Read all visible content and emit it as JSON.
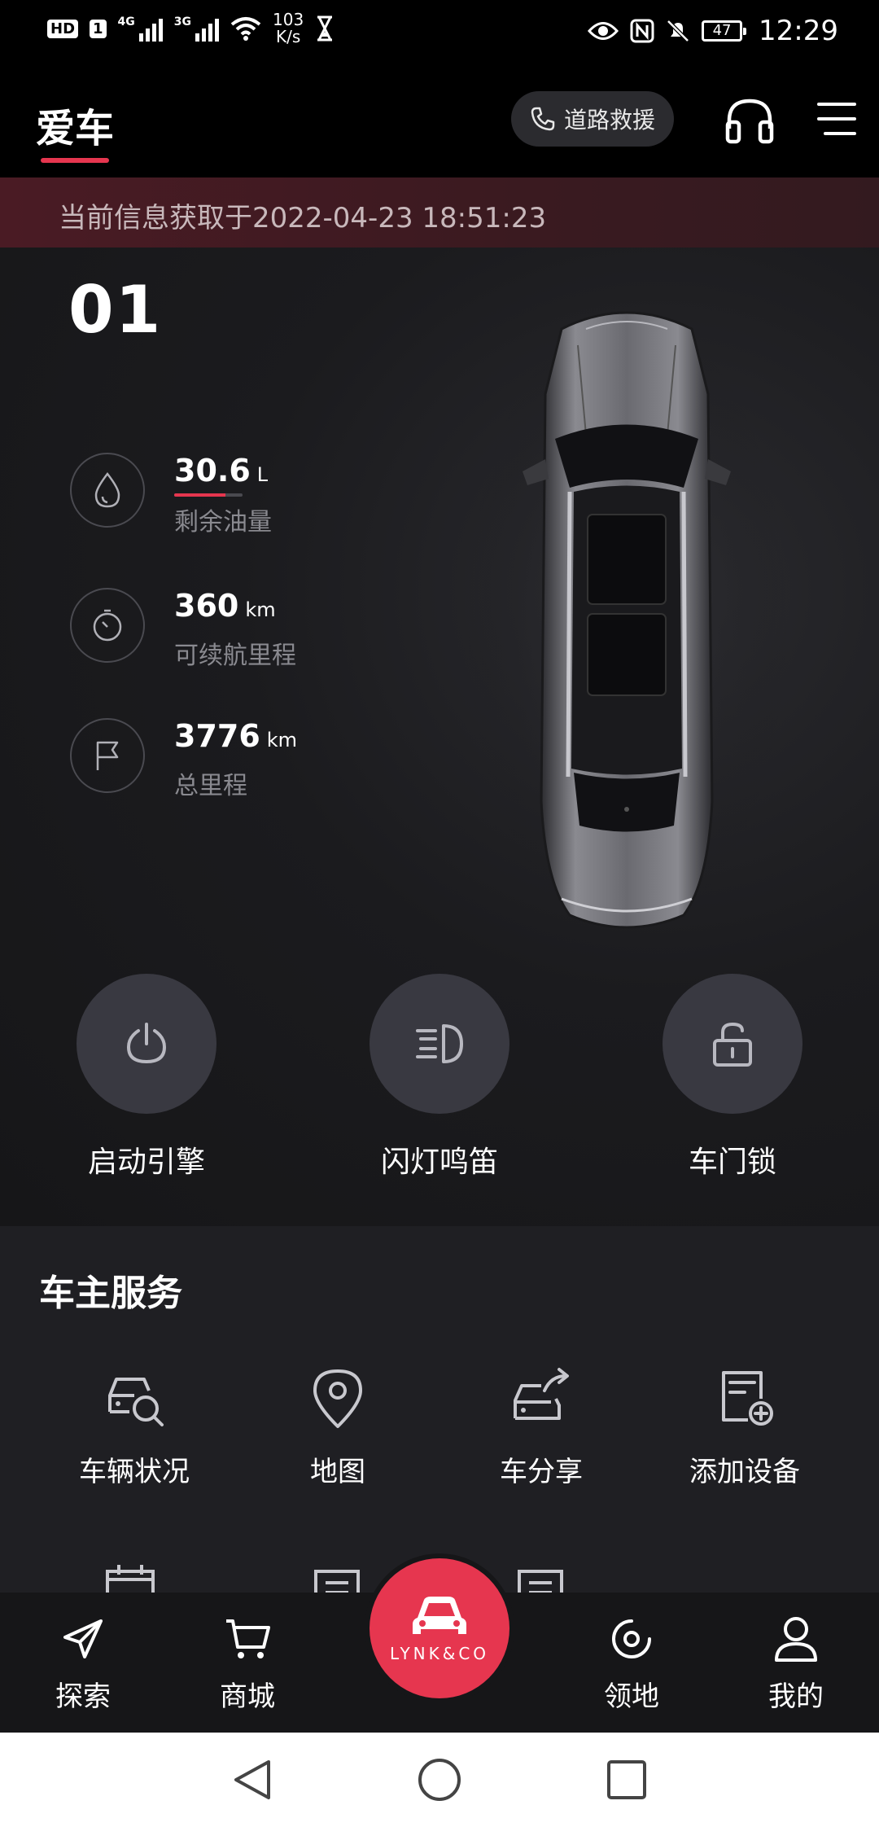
{
  "status_bar": {
    "hd_badge": "HD",
    "sim_badge": "1",
    "net1": "4G",
    "net2": "3G",
    "speed_value": "103",
    "speed_unit": "K/s",
    "battery": "47",
    "time": "12:29"
  },
  "header": {
    "tab_title": "爱车",
    "rescue_label": "道路救援",
    "support_icon": "headset-icon",
    "menu_icon": "hamburger-menu-icon",
    "accent_color": "#e6364f"
  },
  "info_strip": {
    "text": "当前信息获取于2022-04-23 18:51:23"
  },
  "car": {
    "name": "01",
    "stats": [
      {
        "icon": "fuel-drop-icon",
        "value": "30.6",
        "unit": "L",
        "label": "剩余油量",
        "fill_fraction": 0.75
      },
      {
        "icon": "timer-icon",
        "value": "360",
        "unit": "km",
        "label": "可续航里程"
      },
      {
        "icon": "flag-icon",
        "value": "3776",
        "unit": "km",
        "label": "总里程"
      }
    ],
    "actions": [
      {
        "icon": "power-icon",
        "label": "启动引擎"
      },
      {
        "icon": "headlight-icon",
        "label": "闪灯鸣笛"
      },
      {
        "icon": "unlock-icon",
        "label": "车门锁"
      }
    ]
  },
  "services": {
    "title": "车主服务",
    "items": [
      {
        "icon": "car-search-icon",
        "label": "车辆状况"
      },
      {
        "icon": "map-pin-icon",
        "label": "地图"
      },
      {
        "icon": "car-share-icon",
        "label": "车分享"
      },
      {
        "icon": "add-device-icon",
        "label": "添加设备"
      }
    ]
  },
  "bottom_nav": {
    "items": [
      {
        "icon": "send-arrow-icon",
        "label": "探索"
      },
      {
        "icon": "cart-icon",
        "label": "商城"
      },
      {
        "icon": "target-icon",
        "label": "领地"
      },
      {
        "icon": "user-icon",
        "label": "我的"
      }
    ],
    "center_brand": "LYNK&CO",
    "center_icon": "car-front-icon"
  },
  "system_nav": {
    "back_icon": "back-triangle-icon",
    "home_icon": "home-circle-icon",
    "recents_icon": "recents-square-icon"
  }
}
